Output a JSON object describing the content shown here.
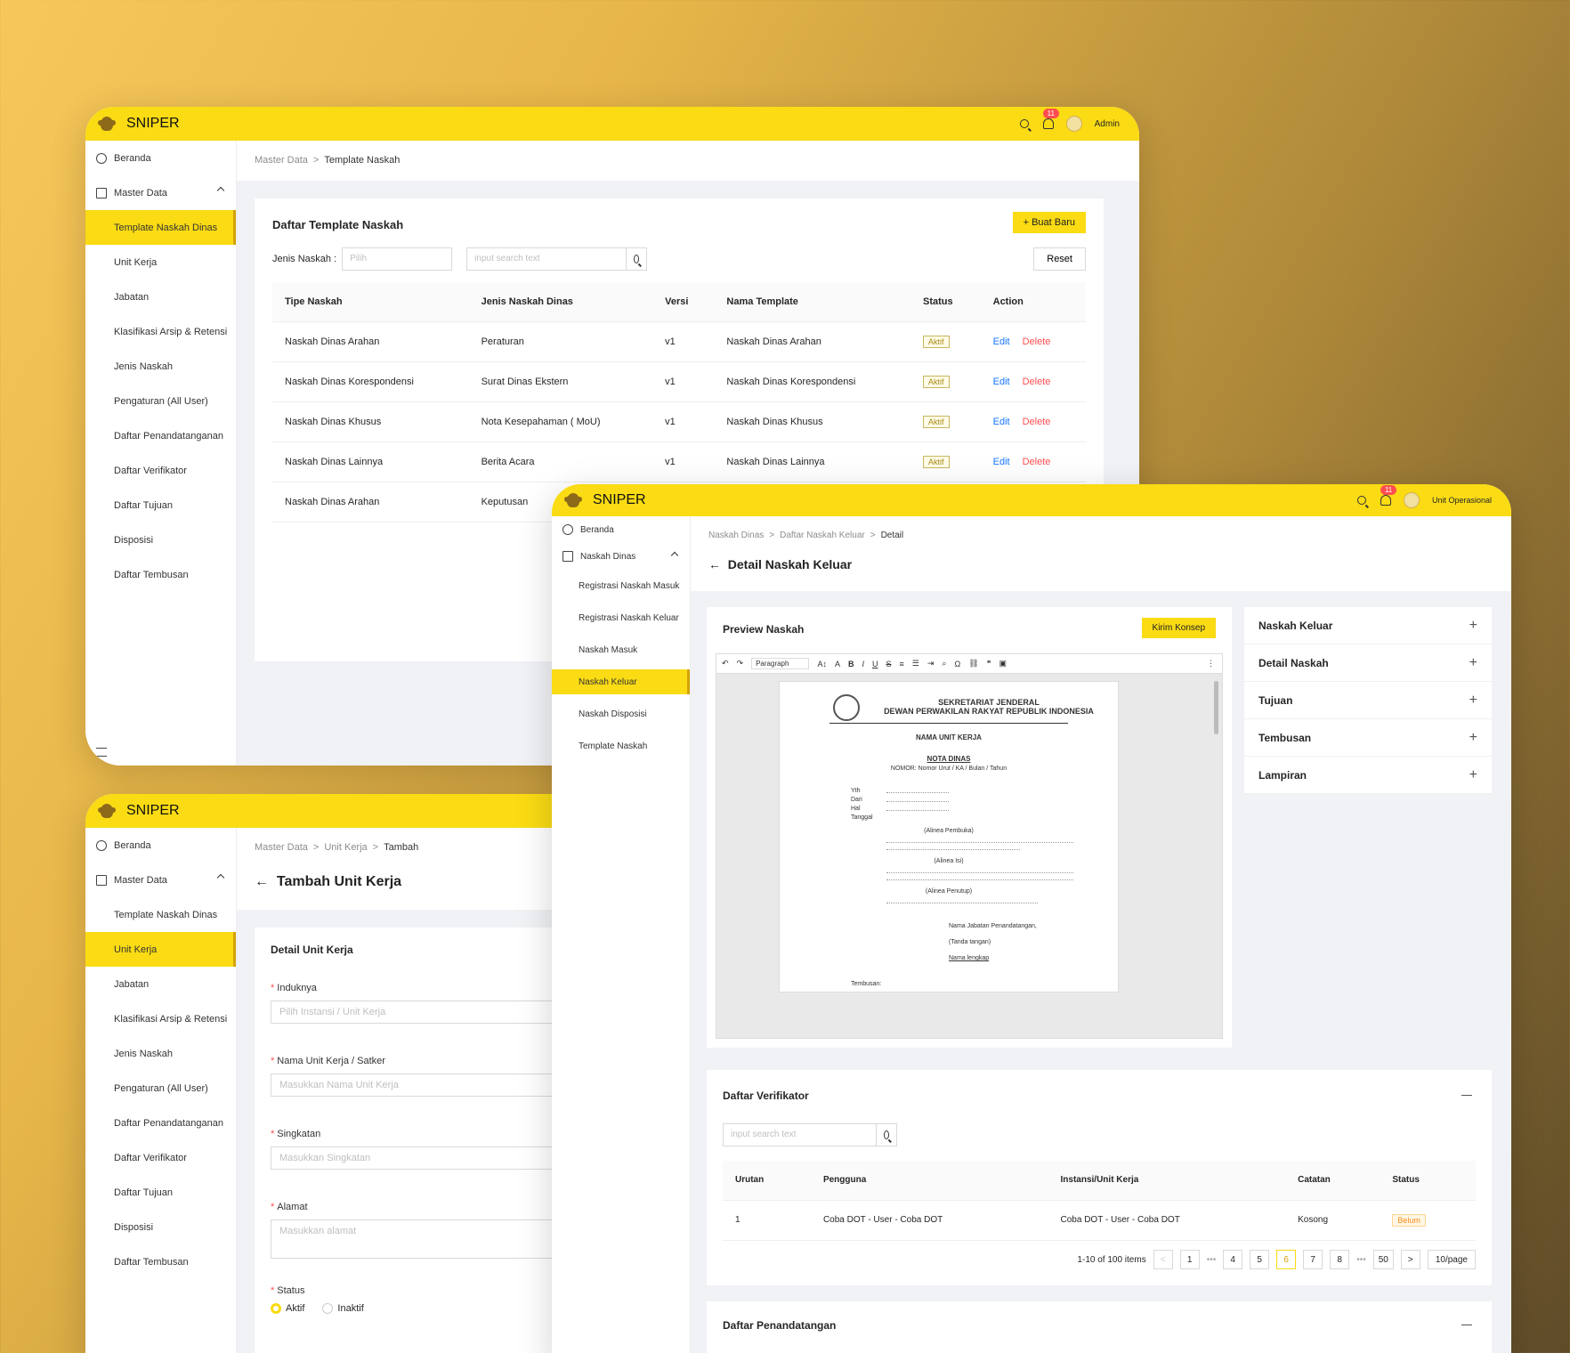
{
  "brand": "SNIPER",
  "w1": {
    "user": "Admin",
    "notif": "11",
    "sidebar": [
      "Beranda",
      "Master Data",
      "Template Naskah Dinas",
      "Unit Kerja",
      "Jabatan",
      "Klasifikasi Arsip & Retensi",
      "Jenis Naskah",
      "Pengaturan (All User)",
      "Daftar Penandatanganan",
      "Daftar Verifikator",
      "Daftar Tujuan",
      "Disposisi",
      "Daftar Tembusan"
    ],
    "crumb": [
      "Master Data",
      ">",
      "Template Naskah"
    ],
    "title": "Daftar Template Naskah",
    "new_btn": "Buat Baru",
    "filter_label": "Jenis Naskah :",
    "select_ph": "Pilih",
    "search_ph": "input search text",
    "reset": "Reset",
    "cols": [
      "Tipe Naskah",
      "Jenis Naskah Dinas",
      "Versi",
      "Nama Template",
      "Status",
      "Action"
    ],
    "rows": [
      [
        "Naskah Dinas Arahan",
        "Peraturan",
        "v1",
        "Naskah Dinas Arahan",
        "Aktif"
      ],
      [
        "Naskah Dinas Korespondensi",
        "Surat Dinas Ekstern",
        "v1",
        "Naskah Dinas Korespondensi",
        "Aktif"
      ],
      [
        "Naskah Dinas Khusus",
        "Nota Kesepahaman ( MoU)",
        "v1",
        "Naskah Dinas Khusus",
        "Aktif"
      ],
      [
        "Naskah Dinas Lainnya",
        "Berita Acara",
        "v1",
        "Naskah Dinas Lainnya",
        "Aktif"
      ],
      [
        "Naskah Dinas Arahan",
        "Keputusan",
        "",
        "",
        ""
      ]
    ],
    "edit": "Edit",
    "delete": "Delete"
  },
  "w3": {
    "sidebar": [
      "Beranda",
      "Master Data",
      "Template Naskah Dinas",
      "Unit Kerja",
      "Jabatan",
      "Klasifikasi Arsip & Retensi",
      "Jenis Naskah",
      "Pengaturan (All User)",
      "Daftar Penandatanganan",
      "Daftar Verifikator",
      "Daftar Tujuan",
      "Disposisi",
      "Daftar Tembusan"
    ],
    "crumb": [
      "Master Data",
      ">",
      "Unit Kerja",
      ">",
      "Tambah"
    ],
    "title": "Tambah Unit Kerja",
    "section": "Detail Unit Kerja",
    "fields": [
      {
        "label": "Induknya",
        "ph": "Pilih Instansi / Unit Kerja"
      },
      {
        "label": "Nama Unit Kerja / Satker",
        "ph": "Masukkan Nama Unit Kerja"
      },
      {
        "label": "Singkatan",
        "ph": "Masukkan Singkatan"
      },
      {
        "label": "Alamat",
        "ph": "Masukkan alamat"
      }
    ],
    "status_label": "Status",
    "opt_on": "Aktif",
    "opt_off": "Inaktif"
  },
  "w2": {
    "user": "Unit Operasional",
    "notif": "11",
    "sidebar": [
      "Beranda",
      "Naskah Dinas",
      "Registrasi Naskah Masuk",
      "Registrasi Naskah Keluar",
      "Naskah Masuk",
      "Naskah Keluar",
      "Naskah Disposisi",
      "Template Naskah"
    ],
    "crumb": [
      "Naskah Dinas",
      ">",
      "Daftar Naskah Keluar",
      ">",
      "Detail"
    ],
    "title": "Detail Naskah Keluar",
    "preview": "Preview Naskah",
    "kirim": "Kirim Konsep",
    "paragraph": "Paragraph",
    "doc": {
      "h1": "SEKRETARIAT JENDERAL",
      "h2": "DEWAN PERWAKILAN RAKYAT REPUBLIK INDONESIA",
      "unit": "NAMA UNIT KERJA",
      "nota": "NOTA DINAS",
      "nomor": "NOMOR: Nomor Urut / KA / Bulan / Tahun",
      "yth": "Yth",
      "dari": "Dari",
      "hal": "Hal",
      "tgl": "Tanggal",
      "a1": "(Alinea Pembuka)",
      "a2": "(Alinea Isi)",
      "a3": "(Alinea Penutup)",
      "jab": "Nama Jabatan Penandatangan,",
      "ttd": "(Tanda tangan)",
      "nama": "Nama lengkap",
      "tembusan": "Tembusan:"
    },
    "acc": [
      "Naskah Keluar",
      "Detail Naskah",
      "Tujuan",
      "Tembusan",
      "Lampiran"
    ],
    "verif": "Daftar Verifikator",
    "search_ph": "input search text",
    "vcols": [
      "Urutan",
      "Pengguna",
      "Instansi/Unit Kerja",
      "Catatan",
      "Status"
    ],
    "vrow": [
      "1",
      "Coba DOT - User - Coba DOT",
      "Coba DOT - User - Coba DOT",
      "Kosong",
      "Belum"
    ],
    "pg": {
      "info": "1-10 of 100 items",
      "pages": [
        "1",
        "4",
        "5",
        "6",
        "7",
        "8",
        "50"
      ],
      "size": "10/page"
    },
    "penanda": "Daftar Penandatangan"
  }
}
